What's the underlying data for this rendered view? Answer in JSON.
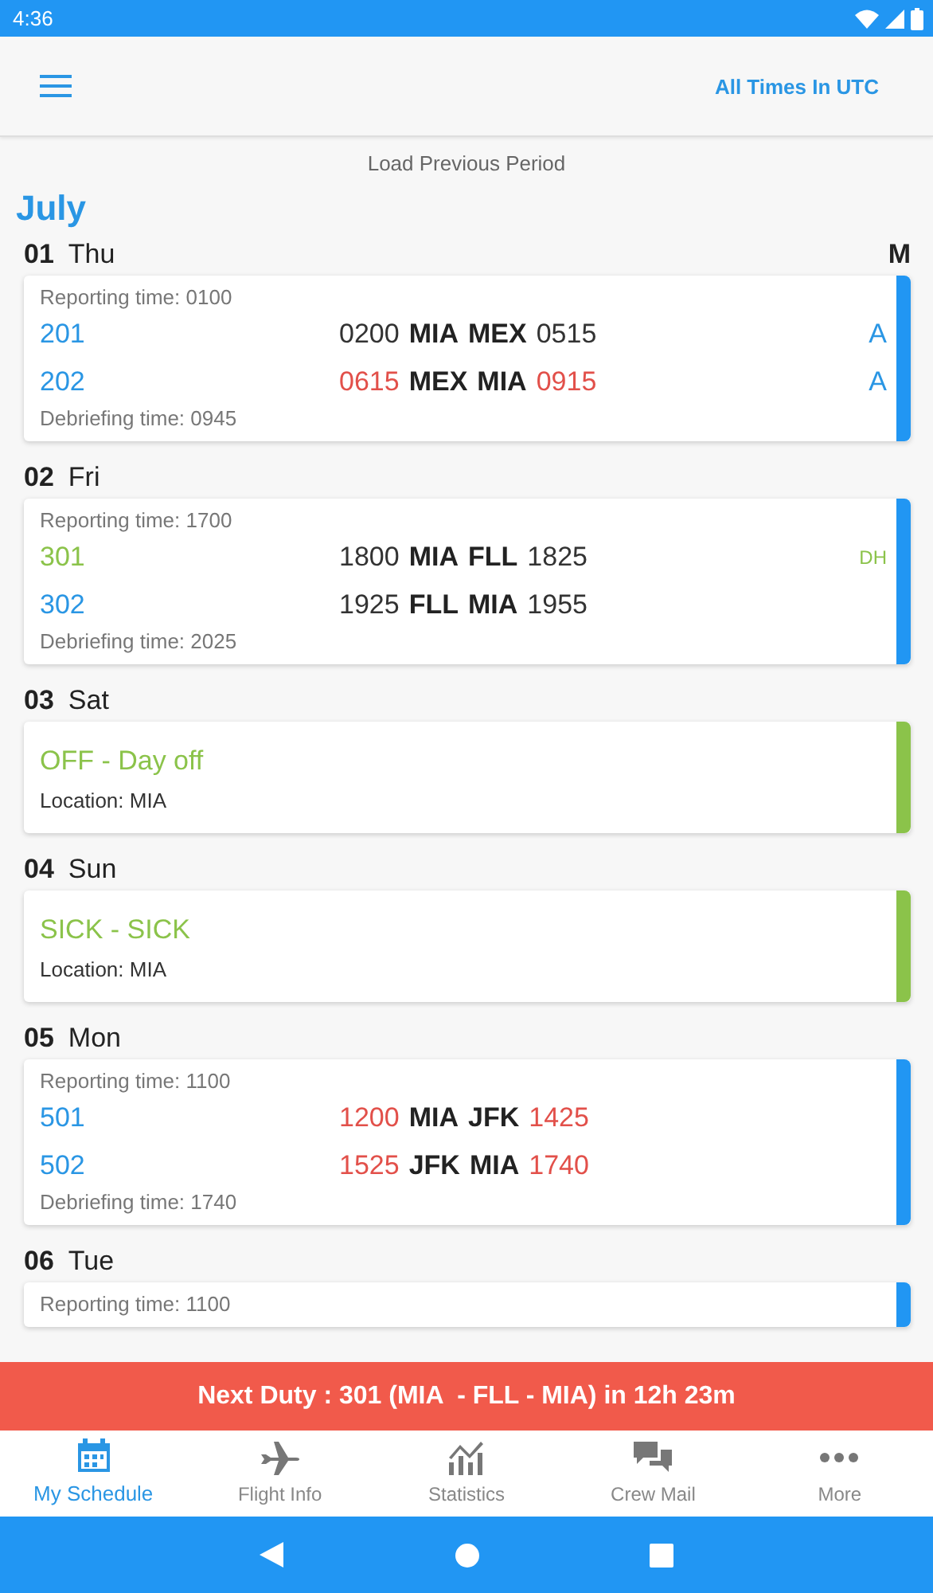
{
  "status_bar": {
    "time": "4:36"
  },
  "app_bar": {
    "timezone_label": "All Times In UTC"
  },
  "load_previous": "Load Previous Period",
  "month": "July",
  "days": [
    {
      "date": "01",
      "weekday": "Thu",
      "marker": "M",
      "duty": {
        "kind": "duty",
        "reporting": "Reporting time: 0100",
        "flights": [
          {
            "number": "201",
            "dep_time": "0200",
            "from": "MIA",
            "to": "MEX",
            "arr_time": "0515",
            "delayed": false,
            "deadhead": false,
            "tag": "A"
          },
          {
            "number": "202",
            "dep_time": "0615",
            "from": "MEX",
            "to": "MIA",
            "arr_time": "0915",
            "delayed": true,
            "deadhead": false,
            "tag": "A"
          }
        ],
        "debriefing": "Debriefing time: 0945"
      }
    },
    {
      "date": "02",
      "weekday": "Fri",
      "duty": {
        "kind": "duty",
        "reporting": "Reporting time: 1700",
        "flights": [
          {
            "number": "301",
            "dep_time": "1800",
            "from": "MIA",
            "to": "FLL",
            "arr_time": "1825",
            "delayed": false,
            "deadhead": true,
            "tag": "DH"
          },
          {
            "number": "302",
            "dep_time": "1925",
            "from": "FLL",
            "to": "MIA",
            "arr_time": "1955",
            "delayed": false,
            "deadhead": false
          }
        ],
        "debriefing": "Debriefing time: 2025"
      }
    },
    {
      "date": "03",
      "weekday": "Sat",
      "duty": {
        "kind": "off",
        "title": "OFF - Day off",
        "location": "Location: MIA"
      }
    },
    {
      "date": "04",
      "weekday": "Sun",
      "duty": {
        "kind": "off",
        "title": "SICK - SICK",
        "location": "Location: MIA"
      }
    },
    {
      "date": "05",
      "weekday": "Mon",
      "duty": {
        "kind": "duty",
        "reporting": "Reporting time: 1100",
        "flights": [
          {
            "number": "501",
            "dep_time": "1200",
            "from": "MIA",
            "to": "JFK",
            "arr_time": "1425",
            "delayed": true,
            "deadhead": false
          },
          {
            "number": "502",
            "dep_time": "1525",
            "from": "JFK",
            "to": "MIA",
            "arr_time": "1740",
            "delayed": true,
            "deadhead": false
          }
        ],
        "debriefing": "Debriefing time: 1740"
      }
    },
    {
      "date": "06",
      "weekday": "Tue",
      "duty": {
        "kind": "duty",
        "reporting": "Reporting time: 1100"
      }
    }
  ],
  "banner": "Next Duty : 301 (MIA  - FLL - MIA) in 12h 23m",
  "tabs": [
    {
      "label": "My Schedule",
      "kind": "calendar",
      "selected": true
    },
    {
      "label": "Flight Info",
      "kind": "plane",
      "selected": false
    },
    {
      "label": "Statistics",
      "kind": "chart",
      "selected": false
    },
    {
      "label": "Crew Mail",
      "kind": "chat",
      "selected": false
    },
    {
      "label": "More",
      "kind": "dots",
      "selected": false
    }
  ]
}
